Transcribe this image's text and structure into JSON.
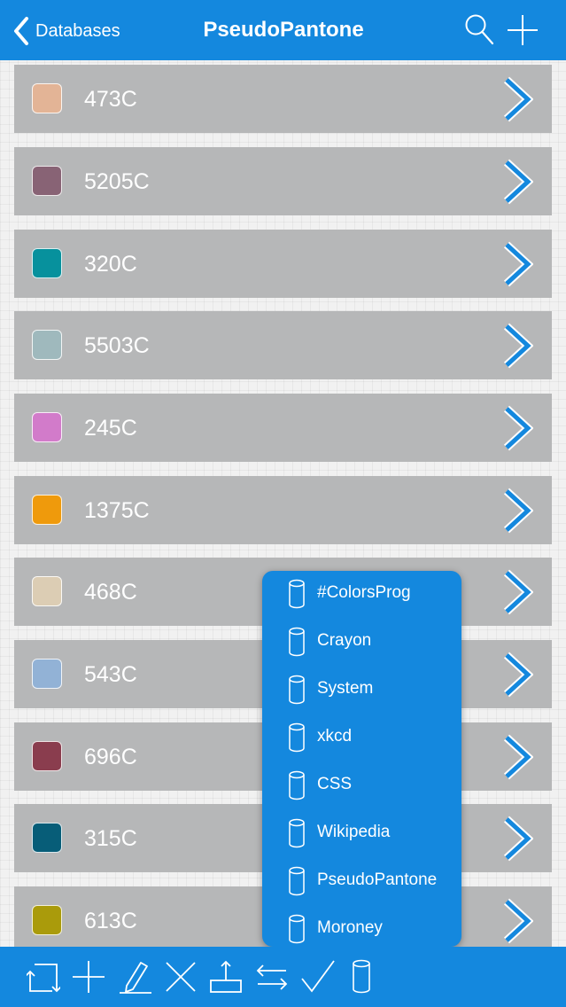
{
  "navbar": {
    "back_label": "Databases",
    "title": "PseudoPantone",
    "icons": [
      "search-icon",
      "add-icon"
    ],
    "background": "#1488de"
  },
  "colors": [
    {
      "name": "473C",
      "swatch": "#e3b496"
    },
    {
      "name": "5205C",
      "swatch": "#886375"
    },
    {
      "name": "320C",
      "swatch": "#07919d"
    },
    {
      "name": "5503C",
      "swatch": "#9fb9bd"
    },
    {
      "name": "245C",
      "swatch": "#d27bca"
    },
    {
      "name": "1375C",
      "swatch": "#ef9a0c"
    },
    {
      "name": "468C",
      "swatch": "#dccdb4"
    },
    {
      "name": "543C",
      "swatch": "#92b2d6"
    },
    {
      "name": "696C",
      "swatch": "#8a3d4e"
    },
    {
      "name": "315C",
      "swatch": "#075d78"
    },
    {
      "name": "613C",
      "swatch": "#aa9b0b"
    }
  ],
  "database_menu": {
    "items": [
      "#ColorsProg",
      "Crayon",
      "System",
      "xkcd",
      "CSS",
      "Wikipedia",
      "PseudoPantone",
      "Moroney"
    ],
    "icon": "database-icon"
  },
  "toolbar": {
    "icons": [
      "rotate-icon",
      "add-icon",
      "edit-pencil-icon",
      "delete-x-icon",
      "export-icon",
      "swap-arrows-icon",
      "checkmark-icon",
      "database-icon"
    ]
  }
}
